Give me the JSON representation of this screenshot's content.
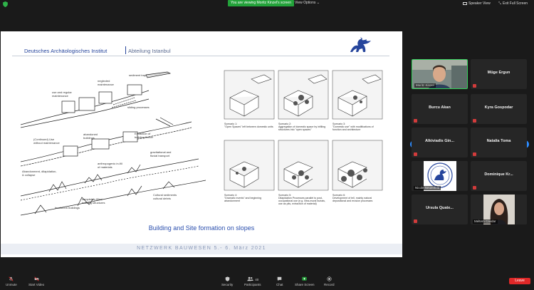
{
  "topbar": {
    "viewing_banner": "You are viewing Moritz Kinzel's screen",
    "view_options": "View Options ⌄",
    "speaker_view": "Speaker View",
    "exit_full_screen": "Exit Full Screen"
  },
  "slide": {
    "institute": "Deutsches Archäologisches Institut",
    "department": "Abteilung Istanbul",
    "caption": "Building and Site formation on slopes",
    "footer": "NETZWERK BAUWESEN 5.- 6. März 2021"
  },
  "participants": [
    {
      "name": "Moritz Kinzel",
      "type": "video",
      "muted": false,
      "active": true
    },
    {
      "name": "Müge Ergun",
      "type": "name",
      "muted": true
    },
    {
      "name": "Burcu Akan",
      "type": "name",
      "muted": true
    },
    {
      "name": "Kyra Gospodar",
      "type": "name",
      "muted": true
    },
    {
      "name": "Alkiviadis Gin...",
      "type": "name",
      "muted": true
    },
    {
      "name": "Natalia Toma",
      "type": "name",
      "muted": true
    },
    {
      "name": "Nicole Neuenfeld",
      "type": "image",
      "muted": true
    },
    {
      "name": "Dominique Kr...",
      "type": "name",
      "muted": true
    },
    {
      "name": "Ursula Quate...",
      "type": "name",
      "muted": true
    },
    {
      "name": "Meltem Cavdar",
      "type": "video",
      "muted": true
    }
  ],
  "toolbar": {
    "unmute": "Unmute",
    "start_video": "Start Video",
    "security": "Security",
    "participants": "Participants",
    "participants_count": "40",
    "chat": "Chat",
    "share_screen": "Share Screen",
    "record": "Record",
    "leave": "Leave"
  },
  "colors": {
    "accent_blue": "#2d8cff",
    "leave_red": "#e02828",
    "share_green": "#23a23a",
    "slide_blue": "#26459c"
  }
}
